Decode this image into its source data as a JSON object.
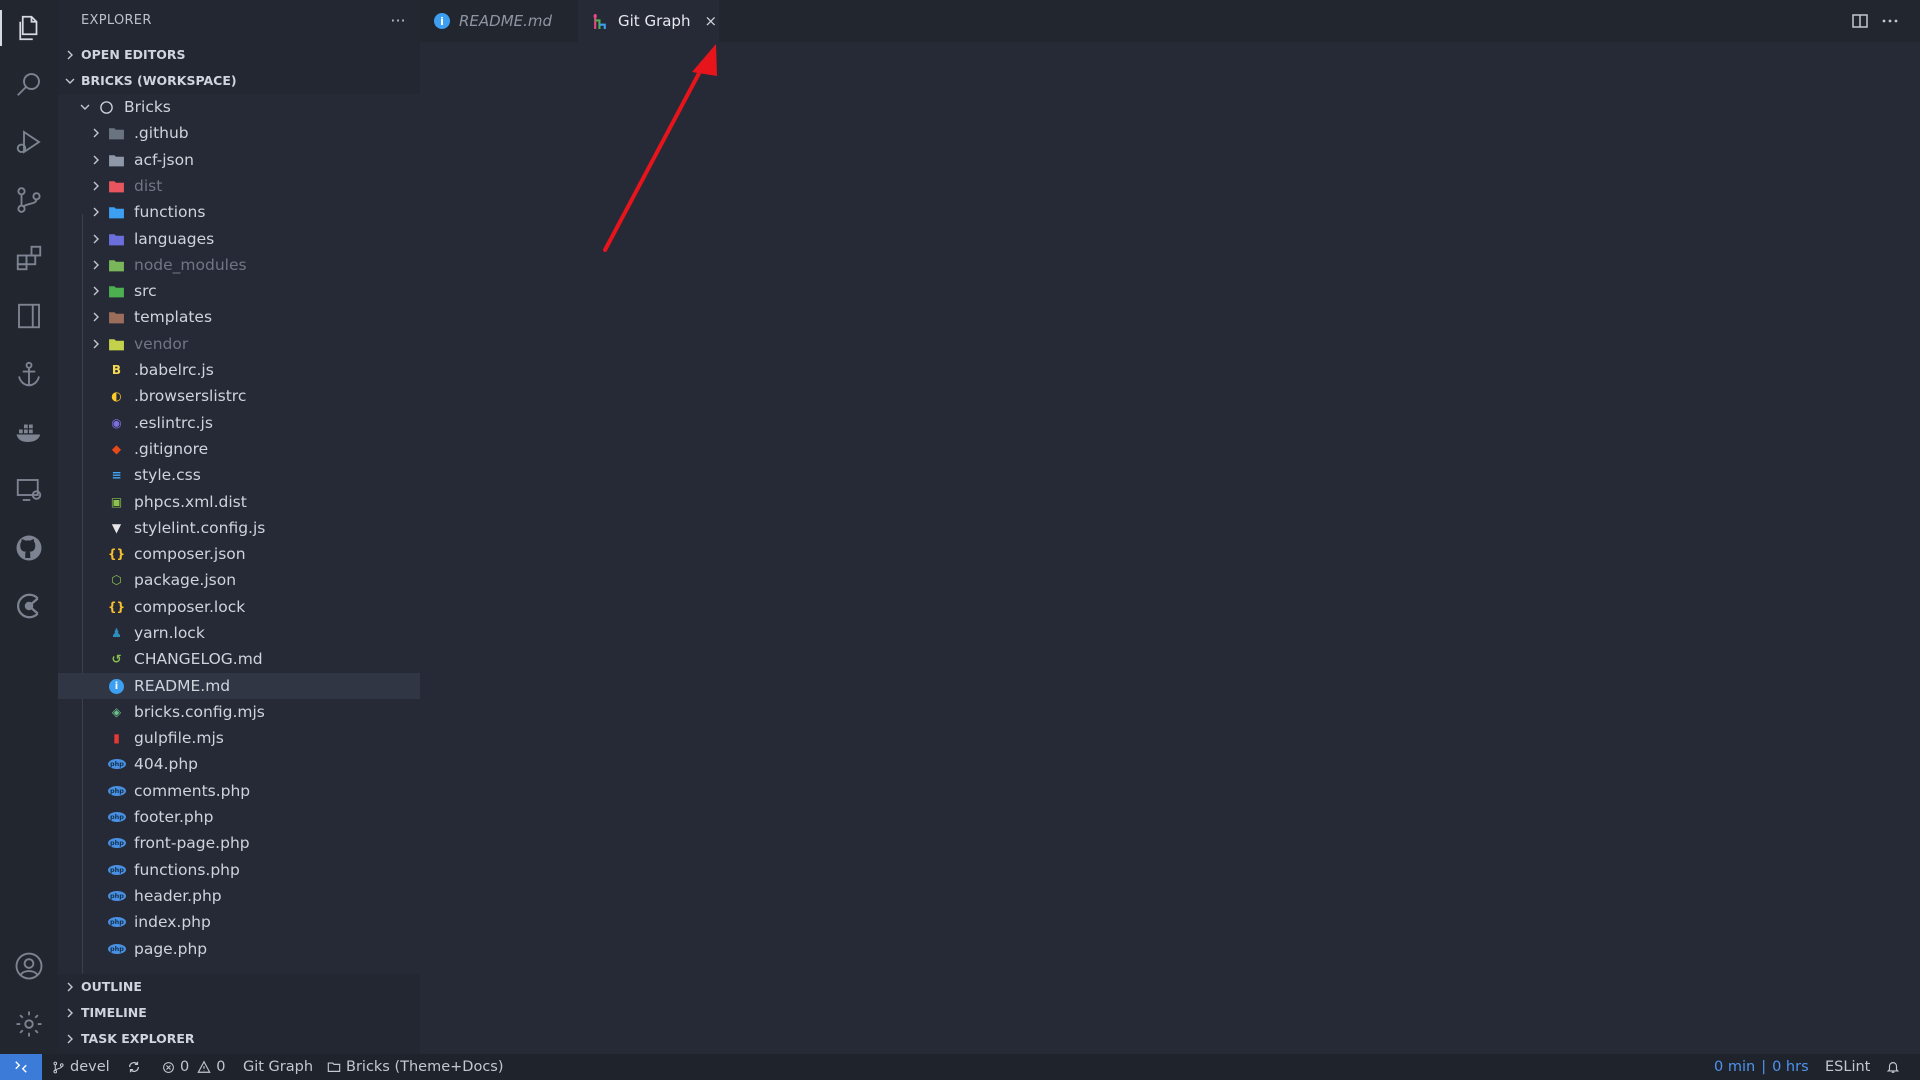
{
  "sidebar": {
    "title": "EXPLORER",
    "more": "···",
    "sections": {
      "open_editors": "OPEN EDITORS",
      "workspace": "BRICKS (WORKSPACE)",
      "outline": "OUTLINE",
      "timeline": "TIMELINE",
      "task_explorer": "TASK EXPLORER"
    },
    "root_folder": "Bricks",
    "folders": [
      {
        "name": ".github",
        "icon": "github-folder-icon",
        "color": "#6a7480",
        "dim": false
      },
      {
        "name": "acf-json",
        "icon": "folder-icon",
        "color": "#8f98a8",
        "dim": false
      },
      {
        "name": "dist",
        "icon": "dist-folder-icon",
        "color": "#e8555f",
        "dim": true
      },
      {
        "name": "functions",
        "icon": "functions-folder-icon",
        "color": "#3d9ff2",
        "dim": false
      },
      {
        "name": "languages",
        "icon": "languages-folder-icon",
        "color": "#6a6fdc",
        "dim": false
      },
      {
        "name": "node_modules",
        "icon": "node-folder-icon",
        "color": "#7ab65a",
        "dim": true
      },
      {
        "name": "src",
        "icon": "src-folder-icon",
        "color": "#4caf50",
        "dim": false
      },
      {
        "name": "templates",
        "icon": "templates-folder-icon",
        "color": "#9c6d5b",
        "dim": false
      },
      {
        "name": "vendor",
        "icon": "vendor-folder-icon",
        "color": "#c4d14b",
        "dim": true
      }
    ],
    "files": [
      {
        "name": ".babelrc.js",
        "icon": "babel-icon",
        "glyph": "B",
        "color": "#f5da55"
      },
      {
        "name": ".browserslistrc",
        "icon": "browserslist-icon",
        "glyph": "◐",
        "color": "#ffca28"
      },
      {
        "name": ".eslintrc.js",
        "icon": "eslint-icon",
        "glyph": "◉",
        "color": "#7b6fe0"
      },
      {
        "name": ".gitignore",
        "icon": "git-icon",
        "glyph": "◆",
        "color": "#e64a19"
      },
      {
        "name": "style.css",
        "icon": "css-icon",
        "glyph": "≡",
        "color": "#42a5f5"
      },
      {
        "name": "phpcs.xml.dist",
        "icon": "xml-icon",
        "glyph": "▣",
        "color": "#8bc34a"
      },
      {
        "name": "stylelint.config.js",
        "icon": "stylelint-icon",
        "glyph": "▼",
        "color": "#e6e6e6"
      },
      {
        "name": "composer.json",
        "icon": "json-icon",
        "glyph": "{}",
        "color": "#fbc02d"
      },
      {
        "name": "package.json",
        "icon": "nodejs-icon",
        "glyph": "⬡",
        "color": "#8bc34a"
      },
      {
        "name": "composer.lock",
        "icon": "json-icon",
        "glyph": "{}",
        "color": "#fbc02d"
      },
      {
        "name": "yarn.lock",
        "icon": "yarn-icon",
        "glyph": "♟",
        "color": "#2c8ebb"
      },
      {
        "name": "CHANGELOG.md",
        "icon": "changelog-icon",
        "glyph": "↺",
        "color": "#8bc34a"
      },
      {
        "name": "README.md",
        "icon": "info-icon",
        "glyph": "i",
        "color": "#3d9ff2",
        "selected": true
      },
      {
        "name": "bricks.config.mjs",
        "icon": "config-cube-icon",
        "glyph": "◈",
        "color": "#6cc18b"
      },
      {
        "name": "gulpfile.mjs",
        "icon": "gulp-icon",
        "glyph": "▮",
        "color": "#e53935"
      },
      {
        "name": "404.php",
        "icon": "php-icon",
        "glyph": "php",
        "color": "#4a90e2"
      },
      {
        "name": "comments.php",
        "icon": "php-icon",
        "glyph": "php",
        "color": "#4a90e2"
      },
      {
        "name": "footer.php",
        "icon": "php-icon",
        "glyph": "php",
        "color": "#4a90e2"
      },
      {
        "name": "front-page.php",
        "icon": "php-icon",
        "glyph": "php",
        "color": "#4a90e2"
      },
      {
        "name": "functions.php",
        "icon": "php-icon",
        "glyph": "php",
        "color": "#4a90e2"
      },
      {
        "name": "header.php",
        "icon": "php-icon",
        "glyph": "php",
        "color": "#4a90e2"
      },
      {
        "name": "index.php",
        "icon": "php-icon",
        "glyph": "php",
        "color": "#4a90e2"
      },
      {
        "name": "page.php",
        "icon": "php-icon",
        "glyph": "php",
        "color": "#4a90e2"
      }
    ]
  },
  "tabs": [
    {
      "label": "README.md",
      "icon": "info-icon",
      "active": false
    },
    {
      "label": "Git Graph",
      "icon": "git-graph-icon",
      "active": true,
      "close": "×"
    }
  ],
  "status": {
    "branch": "devel",
    "errors": "0",
    "warnings": "0",
    "git_graph": "Git Graph",
    "workspace": "Bricks (Theme+Docs)",
    "time_min": "0 min",
    "separator": "|",
    "time_hrs": "0 hrs",
    "eslint": "ESLint"
  },
  "colors": {
    "accent": "#3d7bd9",
    "annotation_arrow": "#e8141c"
  }
}
